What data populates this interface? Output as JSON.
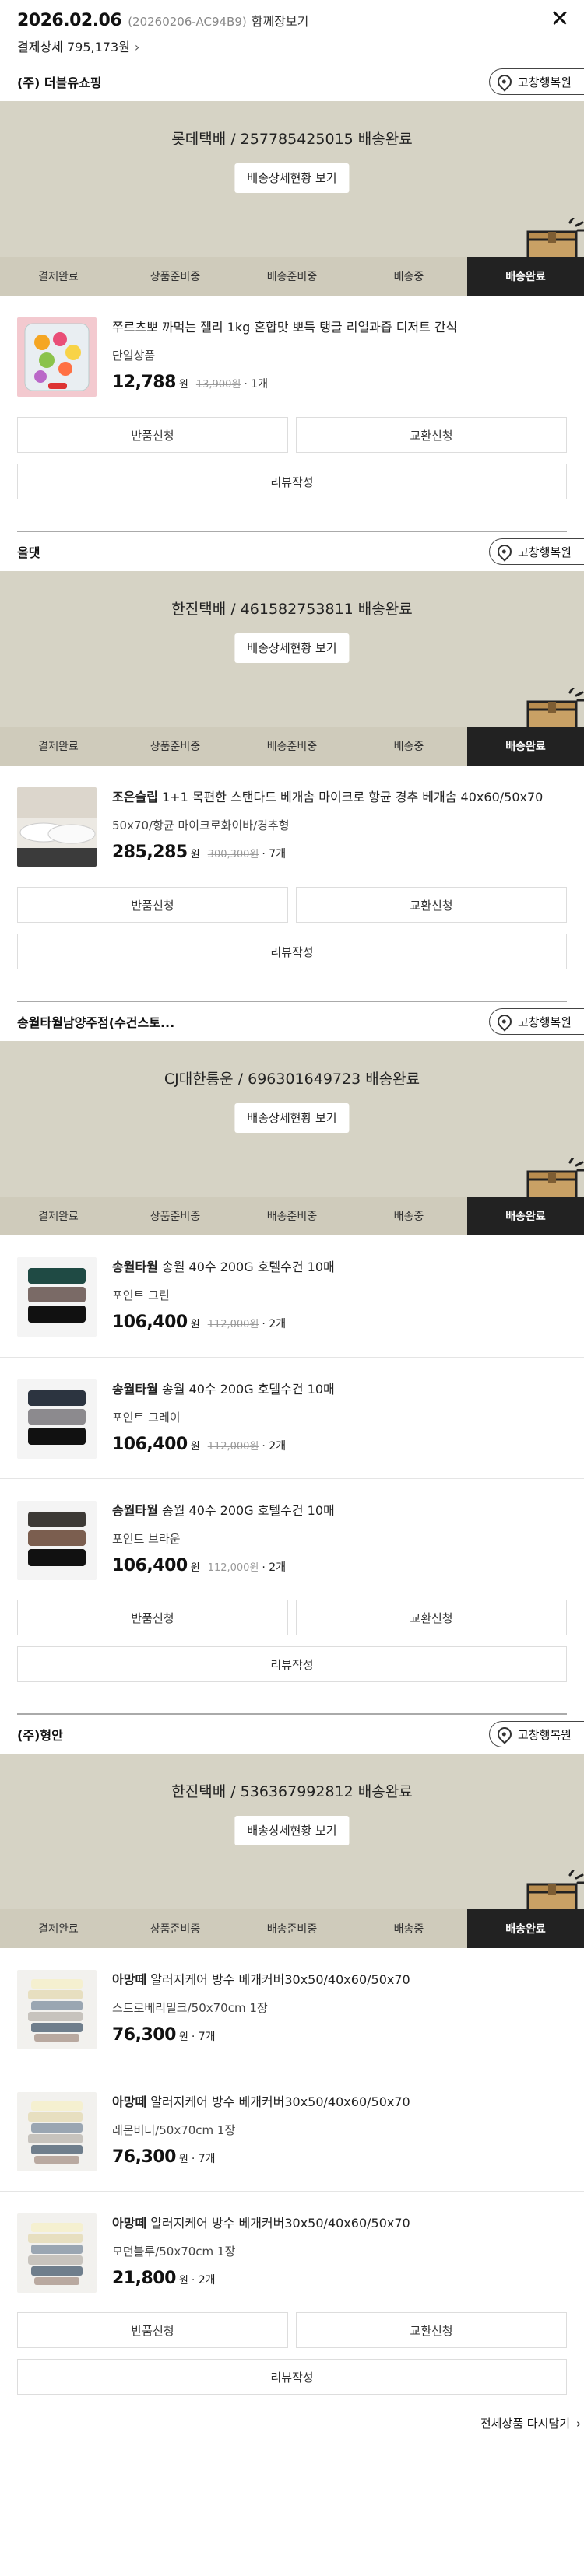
{
  "header": {
    "date": "2026.02.06",
    "order_code": "(20260206-AC94B9)",
    "view_together": "함께장보기",
    "close": "✕",
    "payment": "결제상세 795,173원",
    "chevron": "›"
  },
  "labels": {
    "track": "배송상세현황 보기",
    "store": "고창행복원",
    "return": "반품신청",
    "exchange": "교환신청",
    "review": "리뷰작성",
    "steps": [
      "결제완료",
      "상품준비중",
      "배송준비중",
      "배송중",
      "배송완료"
    ],
    "won": "원"
  },
  "sellers": [
    {
      "name": "(주) 더블유쇼핑",
      "carrier": "롯데택배 / 257785425015 배송완료",
      "items": [
        {
          "brand": "",
          "title": "쭈르츠뽀 까먹는 젤리 1kg 혼합맛 뽀득 탱글 리얼과즙 디저트 간식",
          "option": "단일상품",
          "price": "12,788",
          "old_price": "13,900원",
          "qty": "· 1개"
        }
      ]
    },
    {
      "name": "올댓",
      "carrier": "한진택배 / 461582753811 배송완료",
      "items": [
        {
          "brand": "조은슬립",
          "title": "1+1 목편한 스탠다드 베개솜 마이크로 항균 경추 베개솜 40x60/50x70",
          "option": "50x70/항균 마이크로화이바/경추형",
          "price": "285,285",
          "old_price": "300,300원",
          "qty": "· 7개"
        }
      ]
    },
    {
      "name": "송월타월남양주점(수건스토...",
      "carrier": "CJ대한통운 / 696301649723 배송완료",
      "items": [
        {
          "brand": "송월타월",
          "title": "송월 40수 200G 호텔수건 10매",
          "option": "포인트 그린",
          "price": "106,400",
          "old_price": "112,000원",
          "qty": "· 2개"
        },
        {
          "brand": "송월타월",
          "title": "송월 40수 200G 호텔수건 10매",
          "option": "포인트 그레이",
          "price": "106,400",
          "old_price": "112,000원",
          "qty": "· 2개"
        },
        {
          "brand": "송월타월",
          "title": "송월 40수 200G 호텔수건 10매",
          "option": "포인트 브라운",
          "price": "106,400",
          "old_price": "112,000원",
          "qty": "· 2개"
        }
      ]
    },
    {
      "name": "(주)형안",
      "carrier": "한진택배 / 536367992812 배송완료",
      "items": [
        {
          "brand": "아망떼",
          "title": "알러지케어 방수 베개커버30x50/40x60/50x70",
          "option": "스트로베리밀크/50x70cm 1장",
          "price": "76,300",
          "old_price": "",
          "qty": "· 7개"
        },
        {
          "brand": "아망떼",
          "title": "알러지케어 방수 베개커버30x50/40x60/50x70",
          "option": "레몬버터/50x70cm 1장",
          "price": "76,300",
          "old_price": "",
          "qty": "· 7개"
        },
        {
          "brand": "아망떼",
          "title": "알러지케어 방수 베개커버30x50/40x60/50x70",
          "option": "모던블루/50x70cm 1장",
          "price": "21,800",
          "old_price": "",
          "qty": "· 2개"
        }
      ]
    }
  ],
  "footer": {
    "reorder": "전체상품 다시담기",
    "chevron": "›"
  },
  "colors": {
    "status_bg": "#d6d3c5",
    "active_step": "#222222"
  },
  "icons": {
    "close": "close-icon",
    "store": "location-pin-icon",
    "delivery": "delivery-box-icon"
  }
}
